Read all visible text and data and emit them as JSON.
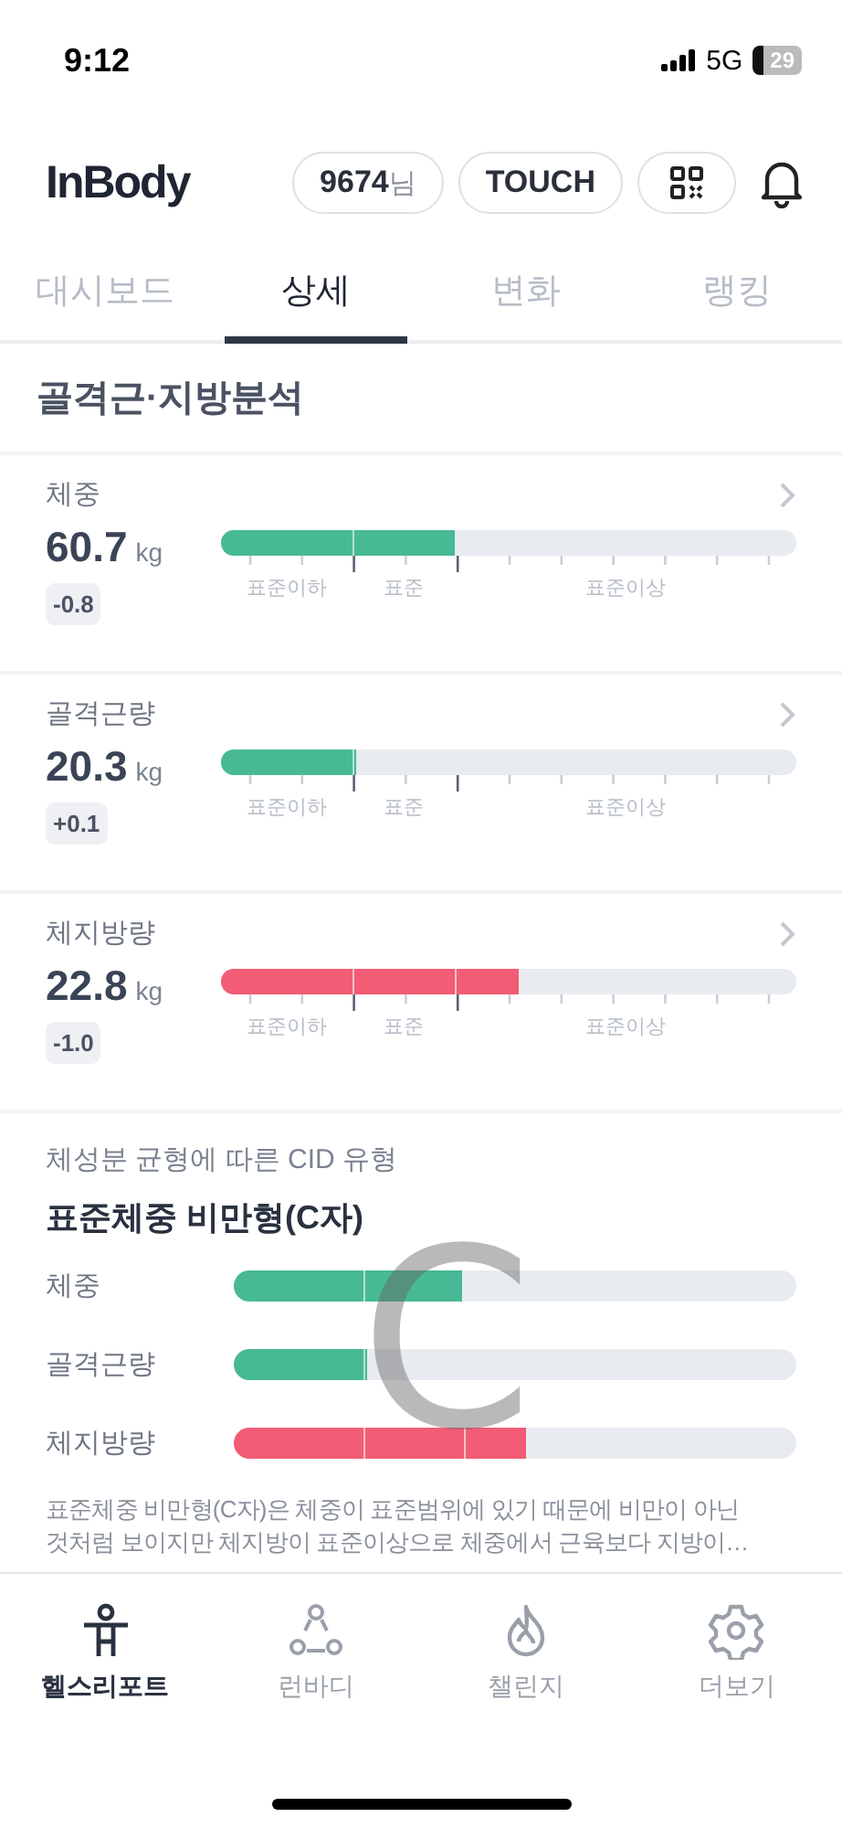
{
  "status_bar": {
    "time": "9:12",
    "network": "5G",
    "battery": "29"
  },
  "header": {
    "logo": "InBody",
    "user": {
      "number": "9674",
      "suffix": "님"
    },
    "touch": "TOUCH"
  },
  "tabs": [
    {
      "label": "대시보드",
      "selected": false
    },
    {
      "label": "상세",
      "selected": true
    },
    {
      "label": "변화",
      "selected": false
    },
    {
      "label": "랭킹",
      "selected": false
    }
  ],
  "section_title": "골격근·지방분석",
  "metrics": [
    {
      "name": "체중",
      "value": "60.7",
      "unit": "kg",
      "delta": "-0.8",
      "color": "#48b995",
      "scale": [
        "표준이하",
        "표준",
        "표준이상"
      ]
    },
    {
      "name": "골격근량",
      "value": "20.3",
      "unit": "kg",
      "delta": "+0.1",
      "color": "#48b995",
      "scale": [
        "표준이하",
        "표준",
        "표준이상"
      ]
    },
    {
      "name": "체지방량",
      "value": "22.8",
      "unit": "kg",
      "delta": "-1.0",
      "color": "#f25c75",
      "scale": [
        "표준이하",
        "표준",
        "표준이상"
      ]
    }
  ],
  "cid": {
    "subtitle": "체성분 균형에 따른 CID 유형",
    "title": "표준체중 비만형(C자)",
    "letter": "C",
    "bars": [
      {
        "name": "체중",
        "color": "#48b995"
      },
      {
        "name": "골격근량",
        "color": "#48b995"
      },
      {
        "name": "체지방량",
        "color": "#f25c75"
      }
    ],
    "description": "표준체중 비만형(C자)은 체중이 표준범위에 있기 때문에 비만이 아닌 것처럼 보이지만 체지방이 표준이상으로 체중에서 근육보다 지방이…"
  },
  "bottom_nav": [
    {
      "label": "헬스리포트",
      "selected": true
    },
    {
      "label": "런바디",
      "selected": false
    },
    {
      "label": "챌린지",
      "selected": false
    },
    {
      "label": "더보기",
      "selected": false
    }
  ]
}
